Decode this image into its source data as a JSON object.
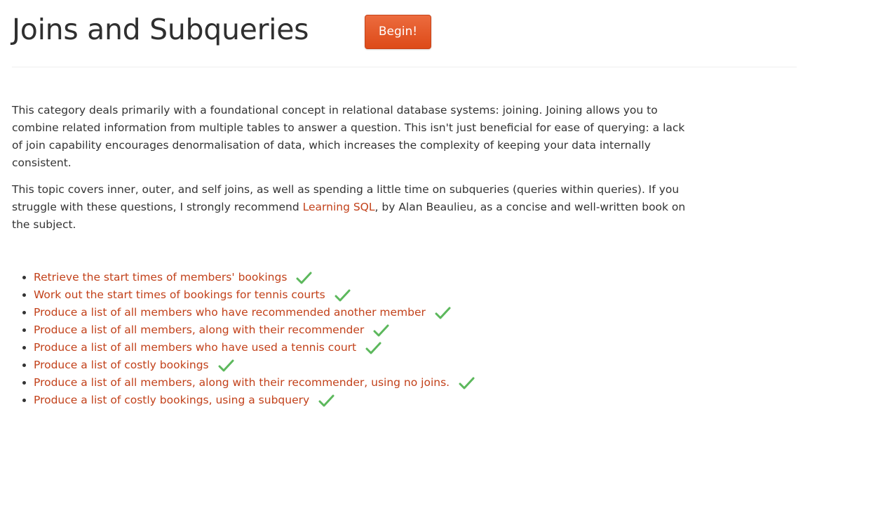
{
  "header": {
    "title": "Joins and Subqueries",
    "begin_label": "Begin!"
  },
  "intro": {
    "p1": "This category deals primarily with a foundational concept in relational database systems: joining. Joining allows you to combine related information from multiple tables to answer a question. This isn't just beneficial for ease of querying: a lack of join capability encourages denormalisation of data, which increases the complexity of keeping your data internally consistent.",
    "p2_before": "This topic covers inner, outer, and self joins, as well as spending a little time on subqueries (queries within queries). If you struggle with these questions, I strongly recommend ",
    "p2_link": "Learning SQL",
    "p2_after": ", by Alan Beaulieu, as a concise and well-written book on the subject."
  },
  "exercises": [
    {
      "label": "Retrieve the start times of members' bookings",
      "completed": true
    },
    {
      "label": "Work out the start times of bookings for tennis courts",
      "completed": true
    },
    {
      "label": "Produce a list of all members who have recommended another member",
      "completed": true
    },
    {
      "label": "Produce a list of all members, along with their recommender",
      "completed": true
    },
    {
      "label": "Produce a list of all members who have used a tennis court",
      "completed": true
    },
    {
      "label": "Produce a list of costly bookings",
      "completed": true
    },
    {
      "label": "Produce a list of all members, along with their recommender, using no joins.",
      "completed": true
    },
    {
      "label": "Produce a list of costly bookings, using a subquery",
      "completed": true
    }
  ],
  "icons": {
    "completed": "check-icon"
  },
  "colors": {
    "link": "#c2411a",
    "button": "#e4582a",
    "check": "#5cb85c"
  }
}
